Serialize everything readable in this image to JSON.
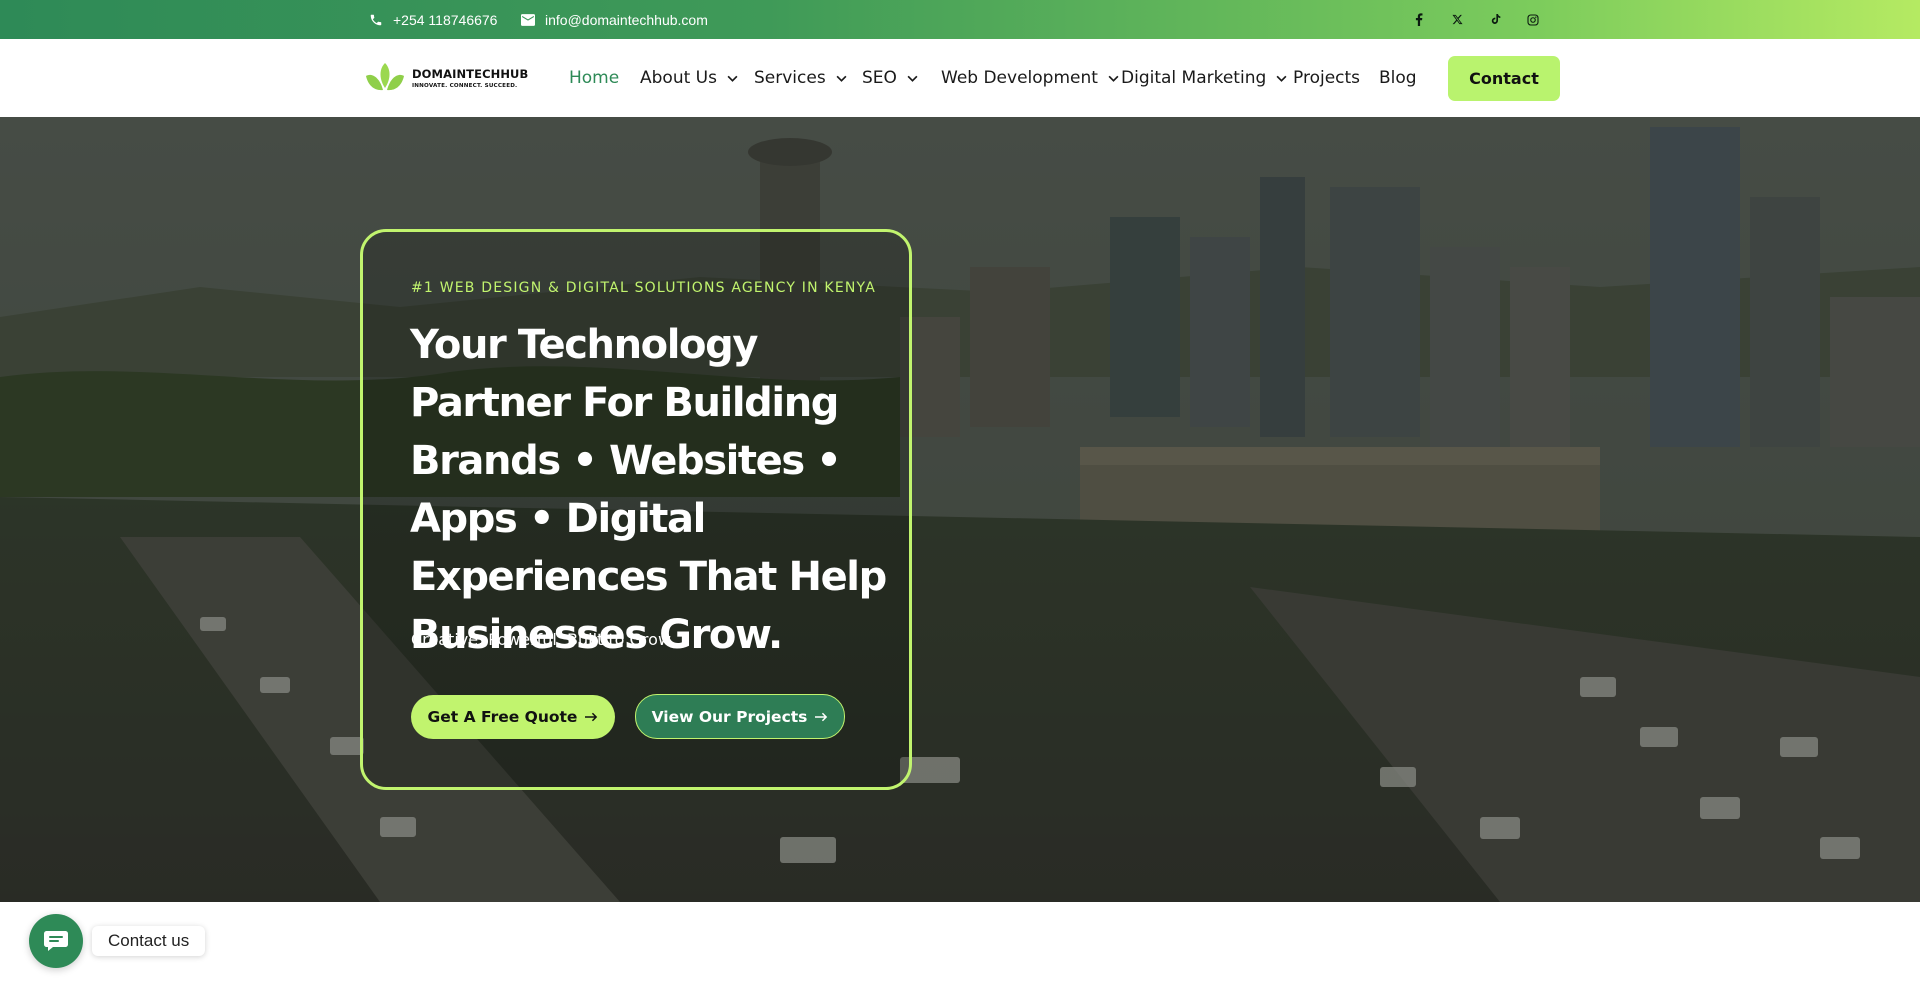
{
  "topbar": {
    "phone": "+254 118746676",
    "email": "info@domaintechhub.com",
    "social_icons": [
      "facebook-icon",
      "x-icon",
      "tiktok-icon",
      "instagram-icon"
    ]
  },
  "logo": {
    "brand": "DOMAINTECHHUB",
    "tagline": "INNOVATE. CONNECT. SUCCEED."
  },
  "nav": {
    "items": [
      {
        "label": "Home",
        "active": true
      },
      {
        "label": "About Us",
        "dropdown": true
      },
      {
        "label": "Services",
        "dropdown": true
      },
      {
        "label": "SEO",
        "dropdown": true
      },
      {
        "label": "Web Development",
        "dropdown": true
      },
      {
        "label": "Digital Marketing",
        "dropdown": true
      },
      {
        "label": "Projects"
      },
      {
        "label": "Blog"
      }
    ],
    "contact_label": "Contact"
  },
  "hero": {
    "eyebrow": "#1 WEB DESIGN & DIGITAL SOLUTIONS AGENCY IN KENYA",
    "headline": "Your Technology Partner For Building Brands • Websites • Apps • Digital Experiences That Help Businesses Grow.",
    "subtext": "Creative. Powerful. Built to Grow.",
    "primary_cta": "Get A Free Quote",
    "secondary_cta": "View Our Projects"
  },
  "chat_widget": {
    "label": "Contact us"
  },
  "colors": {
    "brand_green": "#2e8a57",
    "accent_lime": "#c1f46e"
  }
}
